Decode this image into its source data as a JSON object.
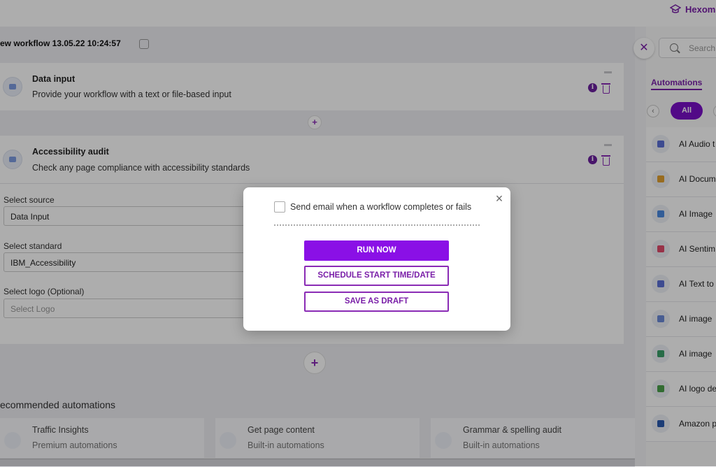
{
  "header": {
    "brand": "Hexom"
  },
  "workflow": {
    "title": "ew workflow 13.05.22 10:24:57",
    "steps": [
      {
        "title": "Data input",
        "desc": "Provide your workflow with a text or file-based input"
      },
      {
        "title": "Accessibility audit",
        "desc": "Check any page compliance with accessibility standards"
      }
    ],
    "form": {
      "source_label": "Select source",
      "source_value": "Data Input",
      "standard_label": "Select standard",
      "standard_value": "IBM_Accessibility",
      "logo_label": "Select logo (Optional)",
      "logo_placeholder": "Select Logo"
    },
    "plus": "+"
  },
  "recommended": {
    "title": "ecommended automations",
    "items": [
      {
        "name": "Traffic Insights",
        "sub": "Premium automations"
      },
      {
        "name": "Get page content",
        "sub": "Built-in automations"
      },
      {
        "name": "Grammar & spelling audit",
        "sub": "Built-in automations"
      }
    ]
  },
  "sidebar": {
    "close": "✕",
    "search_placeholder": "Search",
    "tab": "Automations",
    "chip_all": "All",
    "prev": "‹",
    "items": [
      {
        "name": "AI Audio t",
        "color": "#5a6fd6"
      },
      {
        "name": "AI Docum",
        "color": "#e0a030"
      },
      {
        "name": "AI Image",
        "color": "#4a8ae0"
      },
      {
        "name": "AI Sentim",
        "color": "#e04a6a"
      },
      {
        "name": "AI Text to",
        "color": "#5a6fd6"
      },
      {
        "name": "AI image",
        "color": "#6a8ad8"
      },
      {
        "name": "AI image",
        "color": "#3aa06a"
      },
      {
        "name": "AI logo de",
        "color": "#4aa04a"
      },
      {
        "name": "Amazon p",
        "color": "#2a5ab0"
      }
    ]
  },
  "modal": {
    "close": "×",
    "email_label": "Send email when a workflow completes or fails",
    "email_checked": false,
    "run_now": "RUN NOW",
    "schedule": "SCHEDULE START TIME/DATE",
    "save_draft": "SAVE AS DRAFT"
  }
}
